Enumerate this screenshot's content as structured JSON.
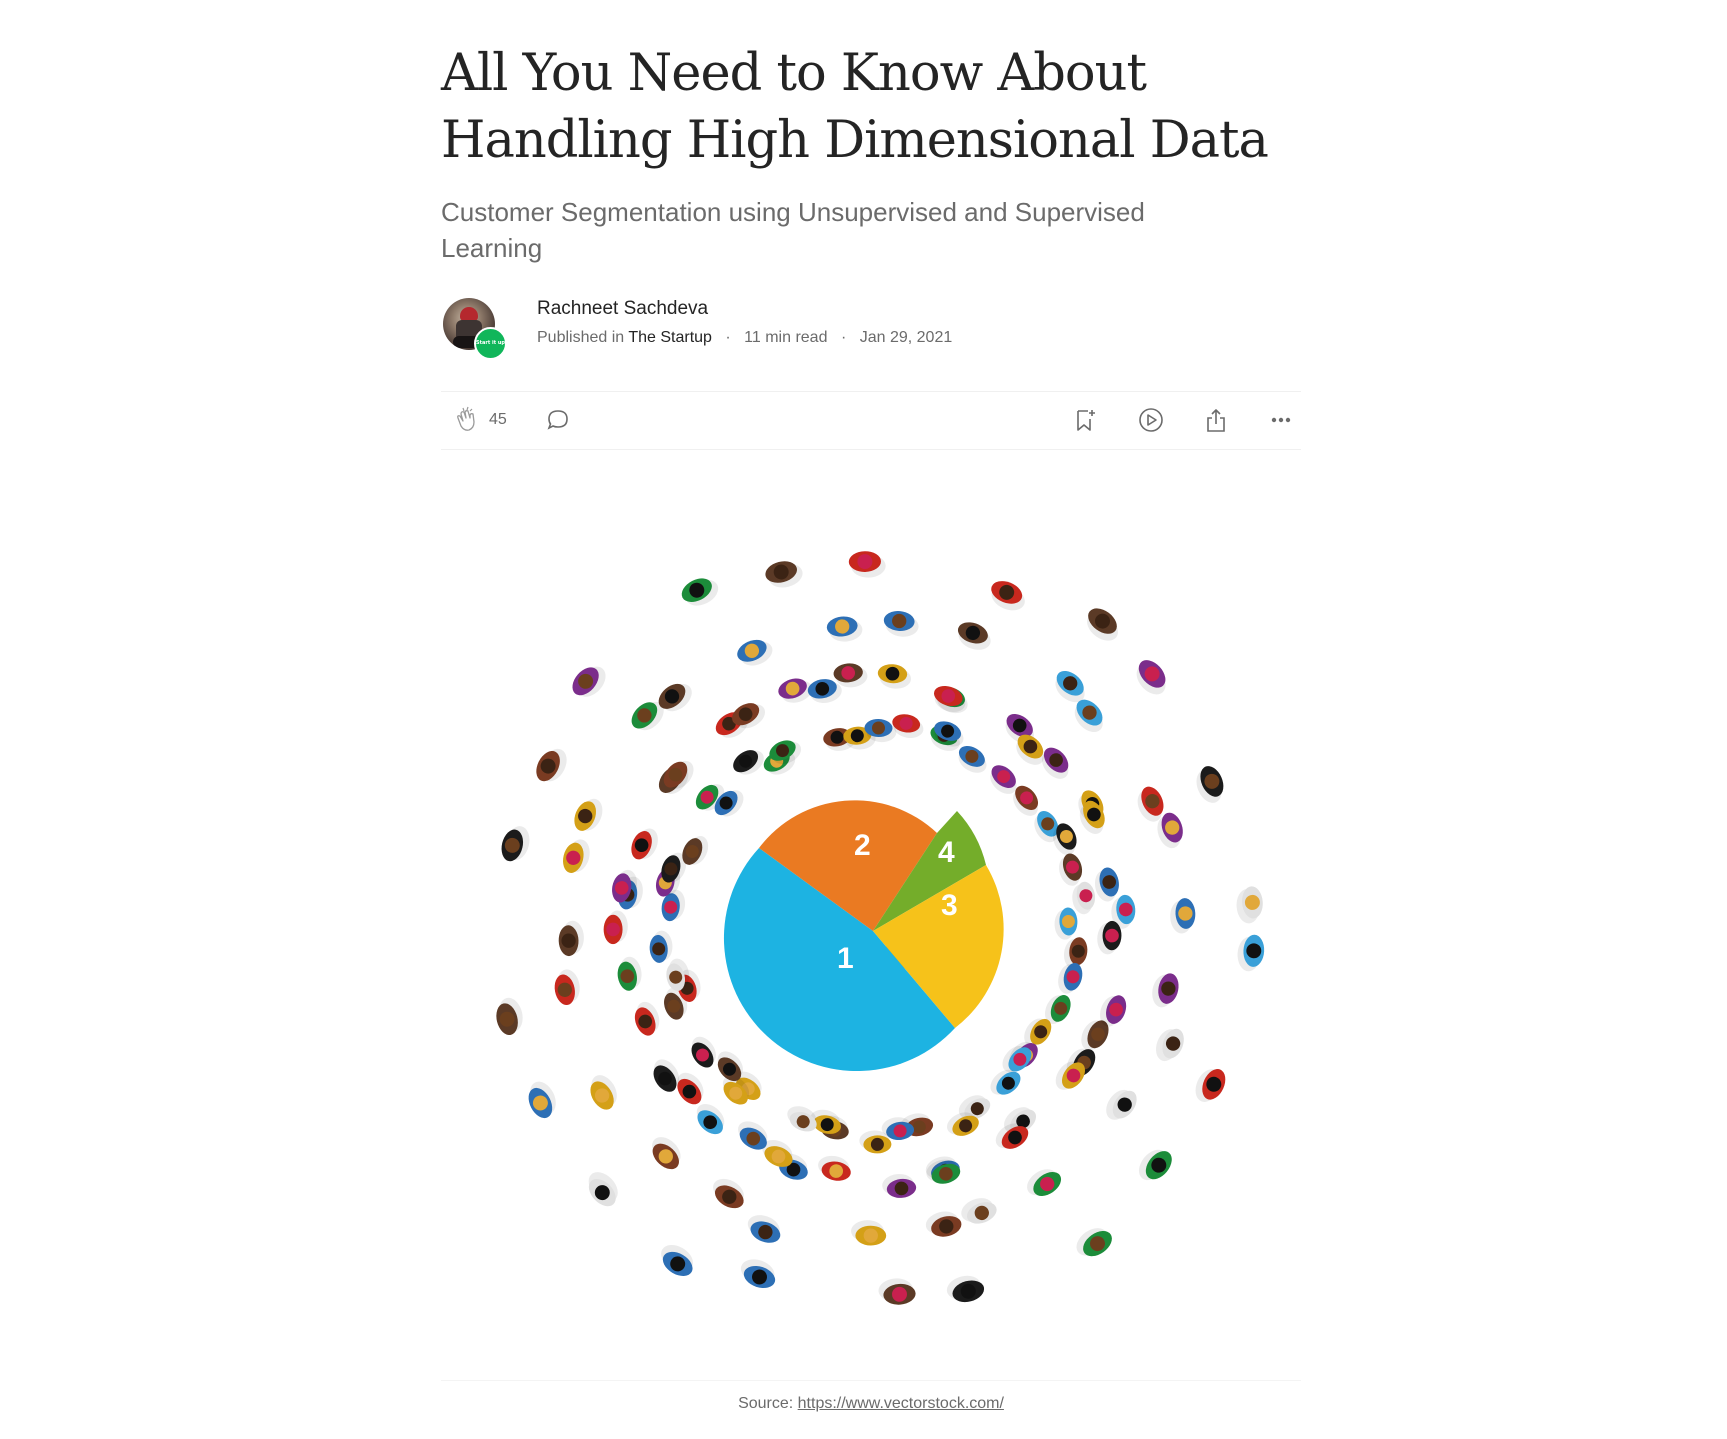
{
  "article": {
    "title_line1": "All You Need to Know About",
    "title_line2": "Handling High Dimensional Data",
    "subtitle": "Customer Segmentation using Unsupervised and Supervised Learning"
  },
  "byline": {
    "author": "Rachneet Sachdeva",
    "published_prefix": "Published in",
    "publication": "The Startup",
    "read_time": "11 min read",
    "date": "Jan 29, 2021",
    "badge_text": "Start it up"
  },
  "actions": {
    "claps": "45",
    "icons": [
      "clap-icon",
      "comment-icon",
      "bookmark-icon",
      "listen-icon",
      "share-icon",
      "more-icon"
    ]
  },
  "hero": {
    "slices": [
      {
        "label": "1",
        "color": "#1db3e2"
      },
      {
        "label": "2",
        "color": "#ea7a22"
      },
      {
        "label": "3",
        "color": "#f6c21a"
      },
      {
        "label": "4",
        "color": "#74ad2a"
      }
    ]
  },
  "caption": {
    "prefix": "Source:",
    "link": "https://www.vectorstock.com/"
  },
  "colors": {
    "text": "#242424",
    "muted": "#6b6b6b",
    "publication_badge": "#10b65a"
  }
}
